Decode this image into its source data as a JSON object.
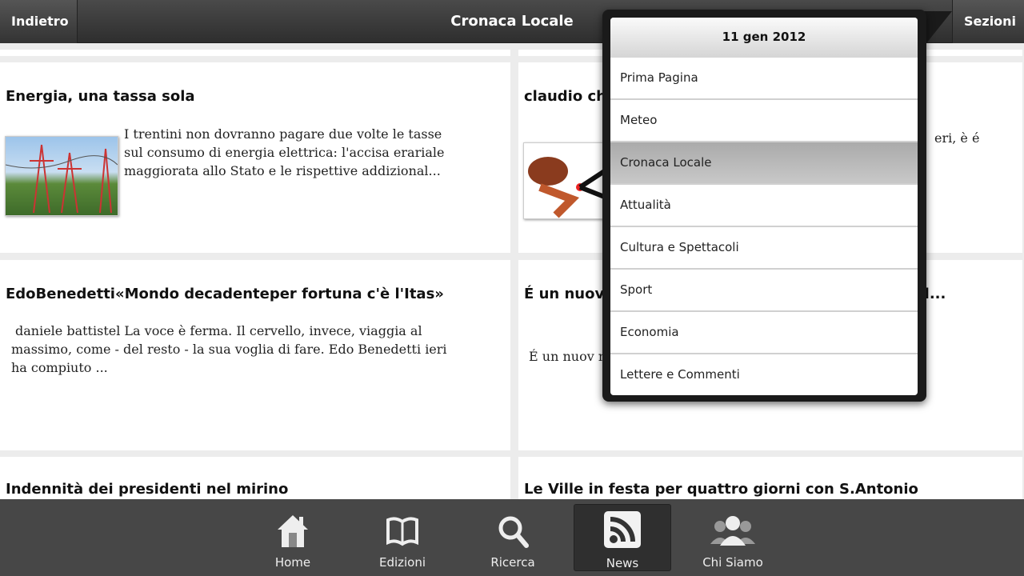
{
  "header": {
    "back_label": "Indietro",
    "title": "Cronaca Locale",
    "sections_label": "Sezioni"
  },
  "articles": [
    {
      "title": "Energia, una tassa sola",
      "text": "I trentini non dovranno pagare due volte le tasse sul consumo di energia elettrica: l'accisa erariale maggiorata allo Stato e le rispettive addizional..."
    },
    {
      "title": "claudio ch                                                        elle da non perde",
      "text": "eri, è                 é"
    },
    {
      "title": "EdoBenedetti«Mondo decadenteper fortuna c'è l'Itas»",
      "text": "daniele battistel La voce è ferma. Il cervello, invece, viaggia al massimo, come - del resto - la sua voglia di fare. Edo Benedetti ieri ha compiuto ..."
    },
    {
      "title": "É un nuov                                                        to alle neo-mamm                                                      si), un tempo pe                                                      un l...",
      "text": "É un nuov                                                         neo-mamme as                                                        po per incont"
    },
    {
      "title": "Indennità dei presidenti nel mirino",
      "text": ""
    },
    {
      "title": "Le Ville in festa per quattro giorni con S.Antonio",
      "text": ""
    }
  ],
  "popup": {
    "date": "11 gen 2012",
    "items": [
      "Prima Pagina",
      "Meteo",
      "Cronaca Locale",
      "Attualità",
      "Cultura e Spettacoli",
      "Sport",
      "Economia",
      "Lettere e Commenti"
    ],
    "selected": "Cronaca Locale"
  },
  "bottom_nav": [
    {
      "label": "Home",
      "icon": "home-icon"
    },
    {
      "label": "Edizioni",
      "icon": "book-icon"
    },
    {
      "label": "Ricerca",
      "icon": "search-icon"
    },
    {
      "label": "News",
      "icon": "rss-icon",
      "active": true
    },
    {
      "label": "Chi Siamo",
      "icon": "people-icon"
    }
  ]
}
